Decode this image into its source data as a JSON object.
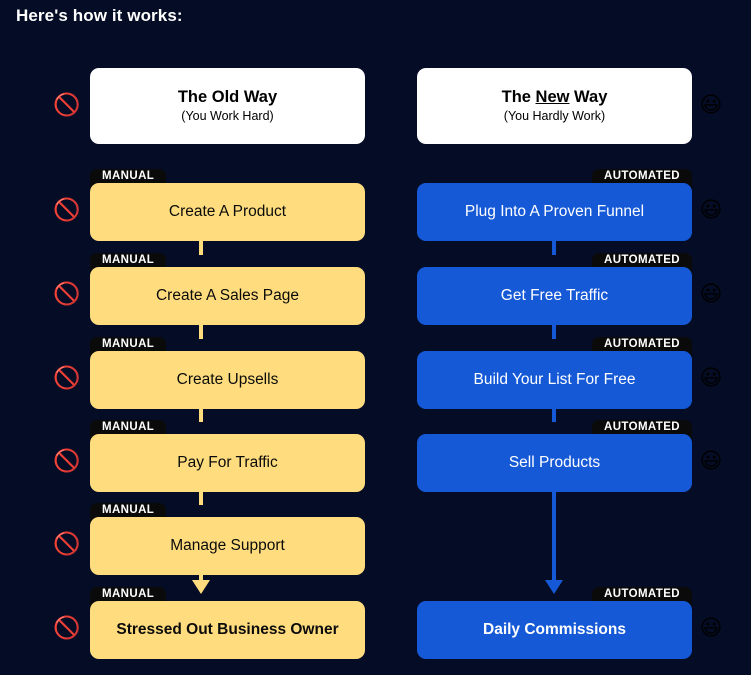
{
  "headline": "Here's how it works:",
  "colors": {
    "background": "#050d26",
    "manual_card": "#ffdd7e",
    "automated_card": "#1559d6",
    "badge": "#0a0a0a",
    "header_card": "#ffffff"
  },
  "columns": {
    "left": {
      "header": {
        "title_prefix": "The Old Way",
        "title_underlined": "",
        "title_suffix": "",
        "subtitle": "(You Work Hard)"
      },
      "marker_icon": "prohibited-icon",
      "marker_glyph": "🚫",
      "badge_label": "MANUAL",
      "steps": [
        {
          "label": "Create A Product",
          "bold": false
        },
        {
          "label": "Create A Sales Page",
          "bold": false
        },
        {
          "label": "Create Upsells",
          "bold": false
        },
        {
          "label": "Pay For Traffic",
          "bold": false
        },
        {
          "label": "Manage Support",
          "bold": false
        },
        {
          "label": "Stressed Out Business Owner",
          "bold": true
        }
      ]
    },
    "right": {
      "header": {
        "title_prefix": "The ",
        "title_underlined": "New",
        "title_suffix": " Way",
        "subtitle": "(You Hardly Work)"
      },
      "marker_icon": "grinning-face-icon",
      "marker_glyph": "😃",
      "badge_label": "AUTOMATED",
      "steps": [
        {
          "label": "Plug Into A Proven Funnel",
          "bold": false
        },
        {
          "label": "Get Free Traffic",
          "bold": false
        },
        {
          "label": "Build Your List For Free",
          "bold": false
        },
        {
          "label": "Sell Products",
          "bold": false
        },
        {
          "label": "Daily Commissions",
          "bold": true
        }
      ]
    }
  }
}
